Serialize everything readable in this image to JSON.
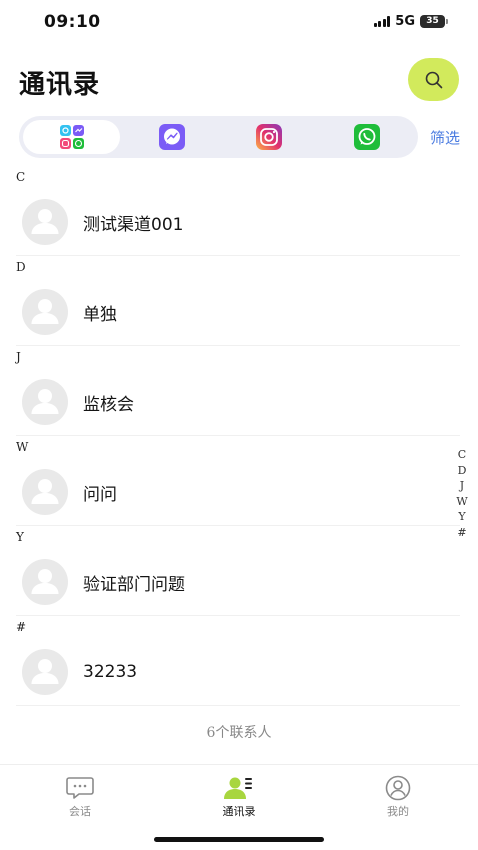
{
  "status_bar": {
    "time": "09:10",
    "network": "5G",
    "battery": "35"
  },
  "header": {
    "title": "通讯录",
    "search_icon": "search-icon"
  },
  "channels": {
    "items": [
      {
        "icon": "all-channels-grid-icon",
        "active": true
      },
      {
        "icon": "messenger-icon",
        "color": "#7b5cf6"
      },
      {
        "icon": "instagram-icon",
        "color": "#e1306c"
      },
      {
        "icon": "whatsapp-icon",
        "color": "#1fbd3a"
      }
    ],
    "filter_label": "筛选"
  },
  "contacts": {
    "sections": [
      {
        "letter": "C",
        "name": "测试渠道001"
      },
      {
        "letter": "D",
        "name": "单独"
      },
      {
        "letter": "J",
        "name": "监核会"
      },
      {
        "letter": "W",
        "name": "问问"
      },
      {
        "letter": "Y",
        "name": "验证部门问题"
      },
      {
        "letter": "#",
        "name": "32233"
      }
    ],
    "count_label": "6个联系人"
  },
  "alpha_index": [
    "C",
    "D",
    "J",
    "W",
    "Y",
    "#"
  ],
  "tab_bar": {
    "chat": "会话",
    "contacts": "通讯录",
    "me": "我的",
    "active_color": "#a8d63f"
  }
}
